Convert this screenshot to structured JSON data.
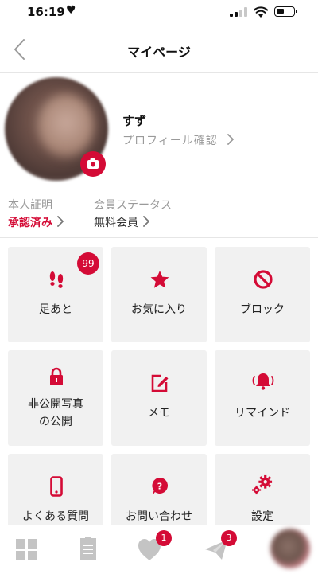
{
  "status_bar": {
    "time": "16:19",
    "heart": "♥"
  },
  "header": {
    "title": "マイページ",
    "back_icon": "chevron-left-icon"
  },
  "profile": {
    "name": "すず",
    "profile_check_label": "プロフィール確認",
    "camera_icon": "camera-icon"
  },
  "stats": {
    "identity_label": "本人証明",
    "identity_value": "承認済み",
    "membership_label": "会員ステータス",
    "membership_value": "無料会員"
  },
  "tiles": [
    {
      "label": "足あと",
      "icon": "footprints-icon",
      "badge": "99"
    },
    {
      "label": "お気に入り",
      "icon": "star-icon"
    },
    {
      "label": "ブロック",
      "icon": "block-icon"
    },
    {
      "label_line1": "非公開写真",
      "label_line2": "の公開",
      "icon": "lock-icon"
    },
    {
      "label": "メモ",
      "icon": "memo-icon"
    },
    {
      "label": "リマインド",
      "icon": "bell-icon"
    },
    {
      "label": "よくある質問",
      "icon": "smartphone-icon"
    },
    {
      "label": "お問い合わせ",
      "icon": "question-bubble-icon"
    },
    {
      "label": "設定",
      "icon": "gears-icon"
    }
  ],
  "tabbar": {
    "likes_badge": "1",
    "messages_badge": "3"
  },
  "colors": {
    "accent": "#d40b36",
    "tile_bg": "#f1f1f1",
    "muted": "#9a9a9a"
  }
}
